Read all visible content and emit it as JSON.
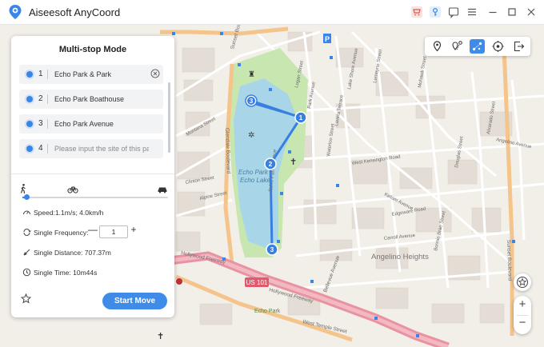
{
  "app": {
    "title": "Aiseesoft AnyCoord"
  },
  "titlebar": {
    "icons": [
      "cart-icon",
      "key-icon",
      "feedback-icon",
      "menu-icon",
      "minimize-icon",
      "maximize-icon",
      "close-icon"
    ]
  },
  "panel": {
    "title": "Multi-stop Mode",
    "stops": [
      {
        "num": "1",
        "name": "Echo Park & Park",
        "placeholder": false
      },
      {
        "num": "2",
        "name": "Echo Park Boathouse",
        "placeholder": false
      },
      {
        "num": "3",
        "name": "Echo Park Avenue",
        "placeholder": false
      },
      {
        "num": "4",
        "name": "Please input the site of this patl",
        "placeholder": true
      }
    ],
    "travel_modes": [
      "walk-icon",
      "bike-icon",
      "car-icon"
    ],
    "speed_level": 0.03,
    "speed": "Speed:1.1m/s; 4.0km/h",
    "frequency_label": "Single Frequency:",
    "frequency_value": "1",
    "minus": "—",
    "plus": "+",
    "distance": "Single Distance: 707.37m",
    "time": "Single Time: 10m44s",
    "start_button": "Start Move"
  },
  "map": {
    "labels": {
      "echo_park": "Echo Park",
      "echo_lake": "Echo Lake",
      "angelino_heights": "Angelino Heights",
      "us101": "US 101",
      "hollywood_fwy": "Hollywood Freeway",
      "hollywood_fwy2": "Hollywood Freeway",
      "glendale": "Glendale Boulevard",
      "echo_park_ave": "Echo Park Avenue",
      "bellevue": "Bellevue Avenue",
      "sunset": "Sunset Boulevard",
      "west_temple": "West Temple Street",
      "echo_park_small": "Echo Park",
      "sunset_blvd_top": "Sunset Boulevard",
      "park_ave": "Park Avenue",
      "logan": "Logan Street",
      "laveta": "Laveta Terrace",
      "waterloo": "Waterloo Street",
      "kensington": "West Kensington Road",
      "douglas": "Douglas Street",
      "alvarado": "Alvarado Street",
      "edgeware": "Edgeware Road",
      "carroll": "Carroll Avenue",
      "kellam": "Kellam Avenue",
      "bonnie_brae": "Bonnie Brae Street",
      "lake_shore": "Lake Shore Avenue",
      "lemoyne": "Lemoyne Street",
      "mohawk": "Mohawk Street",
      "montana": "Montana Street",
      "alpine": "Alpine Street",
      "angelino": "Angelino Avenue",
      "clinton": "Clinton Street"
    },
    "route_waypoints": [
      "1",
      "2",
      "3",
      "3"
    ]
  },
  "toolbar": {
    "tools": [
      "teleport-icon",
      "one-stop-icon",
      "multi-stop-icon",
      "joystick-icon",
      "export-icon"
    ],
    "active": "multi-stop-icon"
  },
  "controls": {
    "zoom_in": "+",
    "zoom_out": "−"
  },
  "colors": {
    "accent": "#3e8ce8",
    "route": "#3a7fe0",
    "lake": "#a8d6e8",
    "park": "#c8e6b0",
    "freeway": "#e892a2"
  }
}
